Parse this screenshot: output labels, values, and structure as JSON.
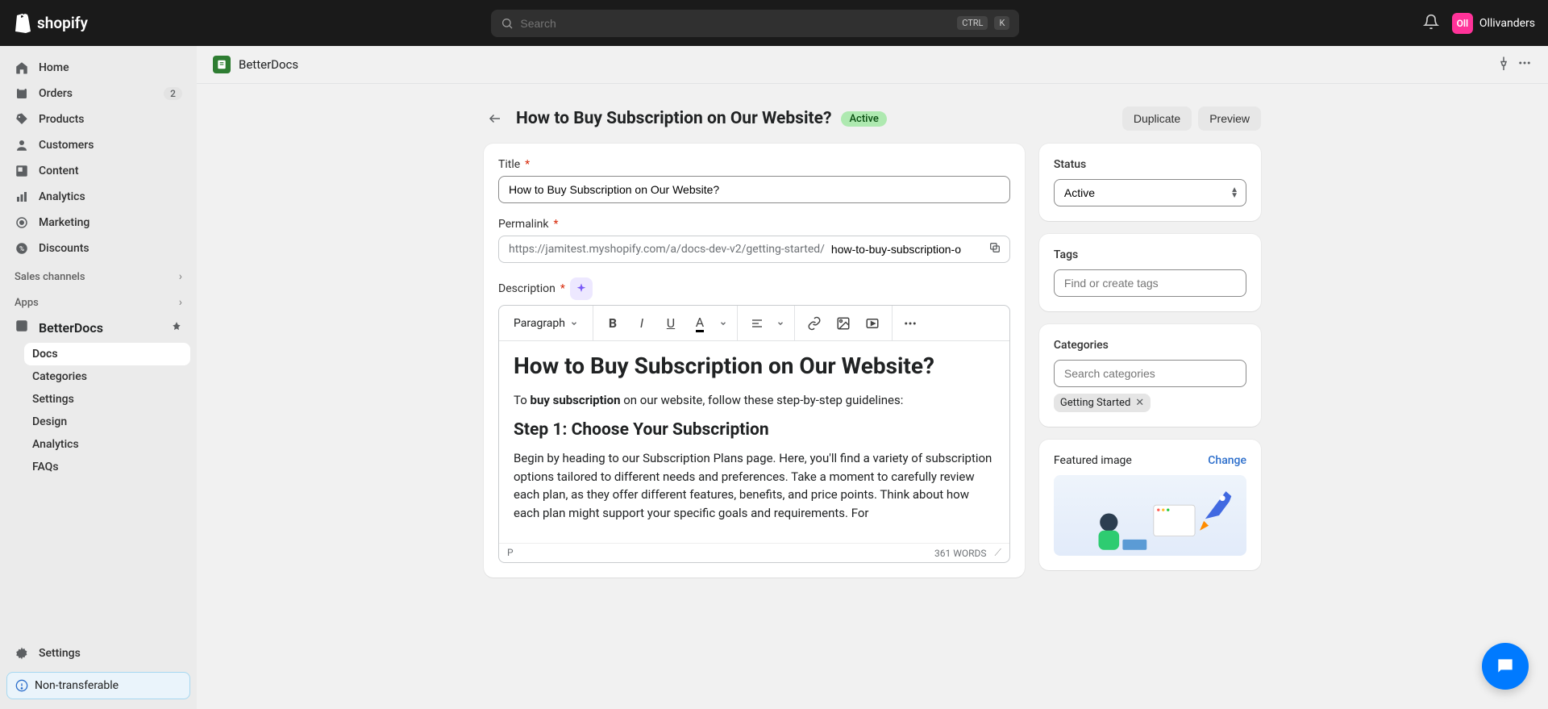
{
  "topbar": {
    "brand": "shopify",
    "search_placeholder": "Search",
    "kbd1": "CTRL",
    "kbd2": "K",
    "user_initials": "Oll",
    "user_name": "Ollivanders"
  },
  "nav": {
    "home": "Home",
    "orders": "Orders",
    "orders_badge": "2",
    "products": "Products",
    "customers": "Customers",
    "content": "Content",
    "analytics": "Analytics",
    "marketing": "Marketing",
    "discounts": "Discounts",
    "sales_channels": "Sales channels",
    "apps": "Apps",
    "app_name": "BetterDocs",
    "sub": {
      "docs": "Docs",
      "categories": "Categories",
      "settings": "Settings",
      "design": "Design",
      "analytics": "Analytics",
      "faqs": "FAQs"
    },
    "settings": "Settings",
    "non_transferable": "Non-transferable"
  },
  "app_header": {
    "name": "BetterDocs"
  },
  "page": {
    "title": "How to Buy Subscription on Our Website?",
    "badge": "Active",
    "duplicate": "Duplicate",
    "preview": "Preview"
  },
  "form": {
    "title_label": "Title",
    "title_value": "How to Buy Subscription on Our Website?",
    "permalink_label": "Permalink",
    "permalink_prefix": "https://jamitest.myshopify.com/a/docs-dev-v2/getting-started/",
    "permalink_value": "how-to-buy-subscription-o",
    "description_label": "Description",
    "paragraph_select": "Paragraph",
    "body_h1": "How to Buy Subscription on Our Website?",
    "body_p1_pre": "To ",
    "body_p1_bold": "buy subscription",
    "body_p1_post": " on our website, follow these step-by-step guidelines:",
    "body_h2": "Step 1: Choose Your Subscription",
    "body_p2": "Begin by heading to our Subscription Plans page. Here, you'll find a variety of subscription options tailored to different needs and preferences. Take a moment to carefully review each plan, as they offer different features, benefits, and price points. Think about how each plan might support your specific goals and requirements. For",
    "footer_path": "P",
    "footer_words": "361 WORDS"
  },
  "side": {
    "status_label": "Status",
    "status_value": "Active",
    "tags_label": "Tags",
    "tags_placeholder": "Find or create tags",
    "categories_label": "Categories",
    "categories_placeholder": "Search categories",
    "category_chip": "Getting Started",
    "featured_label": "Featured image",
    "change": "Change"
  }
}
